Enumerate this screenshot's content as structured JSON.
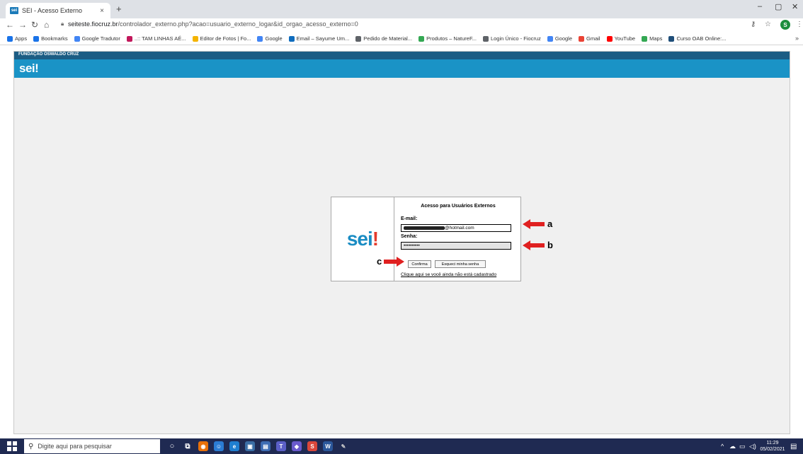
{
  "browser": {
    "tab_title": "SEI - Acesso Externo",
    "tab_favicon_text": "sei",
    "tab_close": "×",
    "new_tab": "+",
    "window_controls": [
      "–",
      "▢",
      "✕"
    ],
    "url_host": "seiteste.fiocruz.br",
    "url_path": "/controlador_externo.php?acao=usuario_externo_logar&id_orgao_acesso_externo=0",
    "profile_initial": "S"
  },
  "bookmarks": [
    {
      "label": "Apps",
      "icon": "apps-grid-icon",
      "color": "#1a73e8"
    },
    {
      "label": "Bookmarks",
      "icon": "star-icon",
      "color": "#1a73e8"
    },
    {
      "label": "Google Tradutor",
      "icon": "translate-icon",
      "color": "#4285f4"
    },
    {
      "label": "..:: TAM LINHAS AÉ...",
      "icon": "tam-icon",
      "color": "#c2185b"
    },
    {
      "label": "Editor de Fotos | Fo...",
      "icon": "photo-editor-icon",
      "color": "#f4b400"
    },
    {
      "label": "Google",
      "icon": "google-icon",
      "color": "#4285f4"
    },
    {
      "label": "Email – Sayume Um...",
      "icon": "outlook-icon",
      "color": "#0f6cbd"
    },
    {
      "label": "Pedido de Material...",
      "icon": "globe-icon",
      "color": "#5f6368"
    },
    {
      "label": "Produtos – NatureF...",
      "icon": "leaf-icon",
      "color": "#34a853"
    },
    {
      "label": "Login Único - Fiocruz",
      "icon": "people-icon",
      "color": "#5f6368"
    },
    {
      "label": "Google",
      "icon": "google-icon",
      "color": "#4285f4"
    },
    {
      "label": "Gmail",
      "icon": "gmail-icon",
      "color": "#ea4335"
    },
    {
      "label": "YouTube",
      "icon": "youtube-icon",
      "color": "#ff0000"
    },
    {
      "label": "Maps",
      "icon": "maps-icon",
      "color": "#34a853"
    },
    {
      "label": "Curso OAB Online:...",
      "icon": "course-icon",
      "color": "#1f4e79"
    }
  ],
  "bookmarks_more": "»",
  "sei": {
    "org_name": "FUNDAÇÃO OSWALDO CRUZ",
    "logo_text": "sei",
    "logo_bang": "!"
  },
  "login": {
    "title": "Acesso para Usuários Externos",
    "email_label": "E-mail:",
    "email_value_visible": "@hotmail.com",
    "password_label": "Senha:",
    "password_value": "••••••••••",
    "confirm_button": "Confirma",
    "forgot_button": "Esqueci minha senha",
    "register_link": "Clique aqui se você ainda não está cadastrado"
  },
  "annotations": {
    "a": "a",
    "b": "b",
    "c": "c",
    "arrow_color": "#e02020"
  },
  "taskbar": {
    "search_placeholder": "Digite aqui para pesquisar",
    "time": "11:29",
    "date": "05/02/2021",
    "tray_icons": [
      "chevron-up-icon",
      "cloud-icon",
      "network-icon",
      "volume-icon"
    ]
  }
}
